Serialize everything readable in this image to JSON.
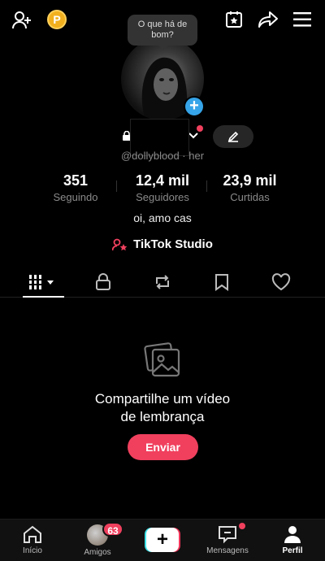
{
  "header": {
    "coin_label": "P",
    "tooltip": "O que há de bom?"
  },
  "profile": {
    "handle": "@dollyblood · her",
    "bio": "oi, amo cas",
    "stats": [
      {
        "value": "351",
        "label": "Seguindo"
      },
      {
        "value": "12,4 mil",
        "label": "Seguidores"
      },
      {
        "value": "23,9 mil",
        "label": "Curtidas"
      }
    ],
    "studio_label": "TikTok Studio"
  },
  "tabs": [
    {
      "icon": "grid-icon"
    },
    {
      "icon": "lock-icon"
    },
    {
      "icon": "repost-icon"
    },
    {
      "icon": "bookmark-icon"
    },
    {
      "icon": "heart-icon"
    }
  ],
  "empty_state": {
    "title_line1": "Compartilhe um vídeo",
    "title_line2": "de lembrança",
    "button": "Enviar"
  },
  "nav": {
    "home": "Início",
    "friends": "Amigos",
    "friends_badge": "63",
    "create": "+",
    "inbox": "Mensagens",
    "profile": "Perfil"
  },
  "colors": {
    "accent": "#f0405e",
    "plus_badge": "#36a4e8",
    "coin": "#f2b01e"
  }
}
